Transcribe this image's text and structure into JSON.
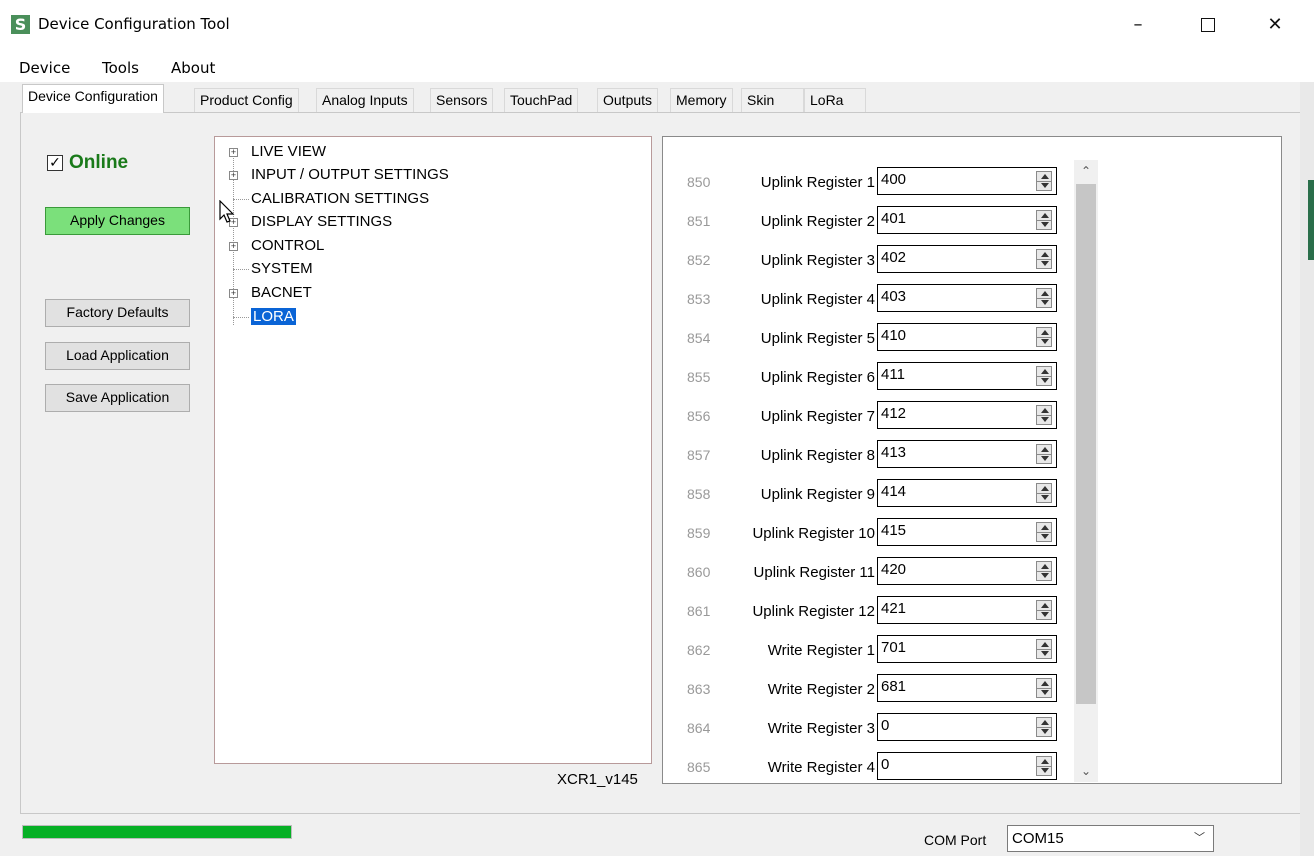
{
  "window": {
    "title": "Device Configuration Tool",
    "icon_letter": "S",
    "controls": {
      "minimize": "–",
      "maximize": "☐",
      "close": "✕"
    }
  },
  "menu": [
    "Device",
    "Tools",
    "About"
  ],
  "tabs": [
    {
      "label": "Device Configuration",
      "active": true
    },
    {
      "label": "Product Config"
    },
    {
      "label": "Analog Inputs"
    },
    {
      "label": "Sensors"
    },
    {
      "label": "TouchPad"
    },
    {
      "label": "Outputs"
    },
    {
      "label": "Memory"
    },
    {
      "label": "Skin"
    },
    {
      "label": "LoRa"
    }
  ],
  "left_panel": {
    "online_checked": true,
    "online_label": "Online",
    "apply_label": "Apply Changes",
    "factory_label": "Factory Defaults",
    "load_label": "Load Application",
    "save_label": "Save Application"
  },
  "tree": [
    {
      "label": "LIVE VIEW",
      "expandable": true
    },
    {
      "label": "INPUT / OUTPUT SETTINGS",
      "expandable": true
    },
    {
      "label": "CALIBRATION SETTINGS",
      "expandable": false
    },
    {
      "label": "DISPLAY SETTINGS",
      "expandable": true
    },
    {
      "label": "CONTROL",
      "expandable": true
    },
    {
      "label": "SYSTEM",
      "expandable": false
    },
    {
      "label": "BACNET",
      "expandable": true
    },
    {
      "label": "LORA",
      "expandable": false,
      "selected": true
    }
  ],
  "version": "XCR1_v145",
  "registers": [
    {
      "num": "850",
      "label": "Uplink Register 1",
      "value": "400"
    },
    {
      "num": "851",
      "label": "Uplink Register 2",
      "value": "401"
    },
    {
      "num": "852",
      "label": "Uplink Register 3",
      "value": "402"
    },
    {
      "num": "853",
      "label": "Uplink Register 4",
      "value": "403"
    },
    {
      "num": "854",
      "label": "Uplink Register 5",
      "value": "410"
    },
    {
      "num": "855",
      "label": "Uplink Register 6",
      "value": "411"
    },
    {
      "num": "856",
      "label": "Uplink Register 7",
      "value": "412"
    },
    {
      "num": "857",
      "label": "Uplink Register 8",
      "value": "413"
    },
    {
      "num": "858",
      "label": "Uplink Register 9",
      "value": "414"
    },
    {
      "num": "859",
      "label": "Uplink Register 10",
      "value": "415"
    },
    {
      "num": "860",
      "label": "Uplink Register 11",
      "value": "420"
    },
    {
      "num": "861",
      "label": "Uplink Register 12",
      "value": "421"
    },
    {
      "num": "862",
      "label": "Write Register 1",
      "value": "701"
    },
    {
      "num": "863",
      "label": "Write Register 2",
      "value": "681"
    },
    {
      "num": "864",
      "label": "Write Register 3",
      "value": "0"
    },
    {
      "num": "865",
      "label": "Write Register 4",
      "value": "0"
    }
  ],
  "status": {
    "progress_fraction": 1.0,
    "progress_color": "#06b025",
    "com_label": "COM Port",
    "com_value": "COM15"
  },
  "colors": {
    "online_green": "#1a7a1a",
    "apply_button_bg": "#7be07b",
    "selection_blue": "#0a64d6"
  }
}
